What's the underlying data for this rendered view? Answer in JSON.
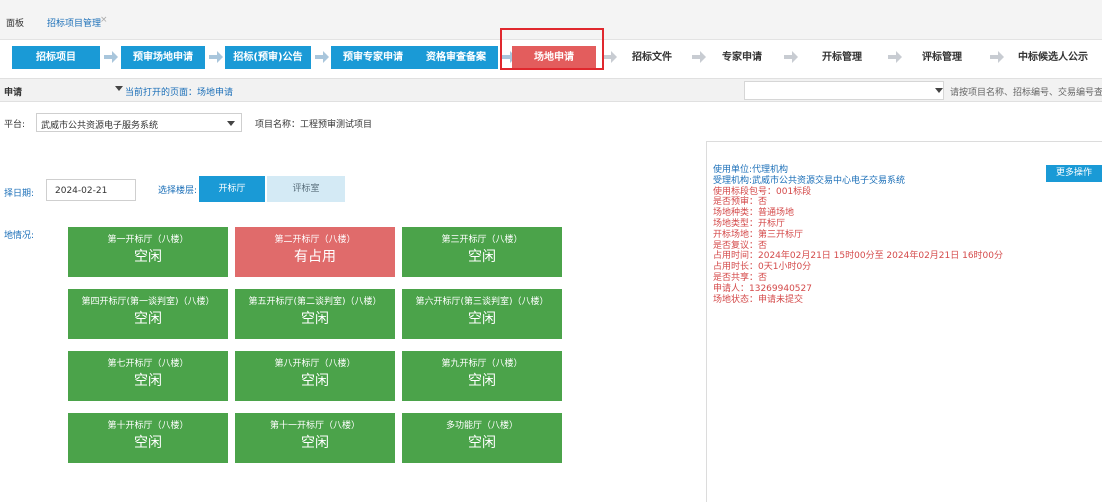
{
  "tabs": {
    "partial_first": "面板",
    "current": "招标项目管理",
    "close": "×"
  },
  "flow": {
    "steps": [
      "招标项目",
      "预审场地申请",
      "招标(预审)公告",
      "预审专家申请",
      "资格审查备案",
      "场地申请",
      "招标文件",
      "专家申请",
      "开标管理",
      "评标管理",
      "中标候选人公示"
    ],
    "current_index": 5,
    "completed_through": 4,
    "colors": {
      "completed": "#1a9ad6",
      "current": "#e35d5d"
    }
  },
  "infobar": {
    "label": "申请",
    "current_page": "当前打开的页面：场地申请",
    "search_placeholder": "请按项目名称、招标编号、交易编号查"
  },
  "platform": {
    "label": "平台:",
    "value": "武威市公共资源电子服务系统",
    "project": "项目名称：工程预审测试项目"
  },
  "date_row": {
    "label": "择日期:",
    "date": "2024-02-21",
    "floor_label": "选择楼层:",
    "open_hall_btn": "开标厅",
    "eval_room_btn": "评标室"
  },
  "venue_label": "地情况:",
  "rooms": [
    {
      "name": "第一开标厅（八楼）",
      "status": "空闲",
      "busy": false
    },
    {
      "name": "第二开标厅（八楼）",
      "status": "有占用",
      "busy": true
    },
    {
      "name": "第三开标厅（八楼）",
      "status": "空闲",
      "busy": false
    },
    {
      "name": "第四开标厅(第一谈判室)（八楼）",
      "status": "空闲",
      "busy": false
    },
    {
      "name": "第五开标厅(第二谈判室)（八楼）",
      "status": "空闲",
      "busy": false
    },
    {
      "name": "第六开标厅(第三谈判室)（八楼）",
      "status": "空闲",
      "busy": false
    },
    {
      "name": "第七开标厅（八楼）",
      "status": "空闲",
      "busy": false
    },
    {
      "name": "第八开标厅（八楼）",
      "status": "空闲",
      "busy": false
    },
    {
      "name": "第九开标厅（八楼）",
      "status": "空闲",
      "busy": false
    },
    {
      "name": "第十开标厅（八楼）",
      "status": "空闲",
      "busy": false
    },
    {
      "name": "第十一开标厅（八楼）",
      "status": "空闲",
      "busy": false
    },
    {
      "name": "多功能厅（八楼）",
      "status": "空闲",
      "busy": false
    }
  ],
  "detail": {
    "more_button": "更多操作",
    "lines": [
      "使用单位:代理机构",
      "受理机构:武威市公共资源交易中心电子交易系统",
      "使用标段包号：001标段",
      "是否预审：否",
      "场地种类：普通场地",
      "场地类型：开标厅",
      "开标场地：第三开标厅",
      "是否复议：否",
      "占用时间：2024年02月21日 15时00分至 2024年02月21日 16时00分",
      "占用时长：0天1小时0分",
      "是否共享：否",
      "申请人：13269940527",
      "场地状态：申请未提交"
    ]
  }
}
